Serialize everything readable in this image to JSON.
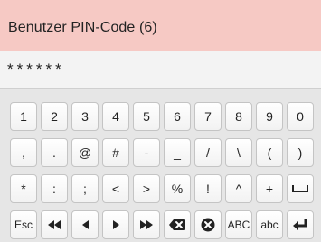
{
  "header": {
    "title": "Benutzer PIN-Code (6)"
  },
  "input": {
    "value": "******"
  },
  "keyboard": {
    "row1": [
      "1",
      "2",
      "3",
      "4",
      "5",
      "6",
      "7",
      "8",
      "9",
      "0"
    ],
    "row2": [
      ",",
      ".",
      "@",
      "#",
      "-",
      "_",
      "/",
      "\\",
      "(",
      ")"
    ],
    "row3": [
      "*",
      ":",
      ";",
      "<",
      ">",
      "%",
      "!",
      "^",
      "+"
    ],
    "row4": {
      "esc": "Esc",
      "abc_upper": "ABC",
      "abc_lower": "abc"
    }
  },
  "icons": {
    "space": "space-icon",
    "rewind": "double-left-arrow-icon",
    "left": "left-arrow-icon",
    "right": "right-arrow-icon",
    "fast_forward": "double-right-arrow-icon",
    "backspace": "backspace-icon",
    "clear": "clear-icon",
    "enter": "enter-icon"
  }
}
